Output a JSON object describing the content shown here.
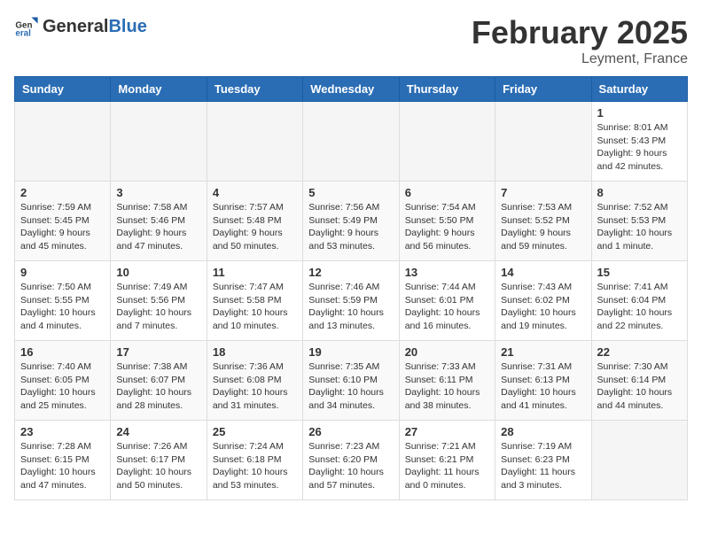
{
  "header": {
    "logo_general": "General",
    "logo_blue": "Blue",
    "month_title": "February 2025",
    "location": "Leyment, France"
  },
  "weekdays": [
    "Sunday",
    "Monday",
    "Tuesday",
    "Wednesday",
    "Thursday",
    "Friday",
    "Saturday"
  ],
  "weeks": [
    [
      {
        "day": "",
        "info": ""
      },
      {
        "day": "",
        "info": ""
      },
      {
        "day": "",
        "info": ""
      },
      {
        "day": "",
        "info": ""
      },
      {
        "day": "",
        "info": ""
      },
      {
        "day": "",
        "info": ""
      },
      {
        "day": "1",
        "info": "Sunrise: 8:01 AM\nSunset: 5:43 PM\nDaylight: 9 hours and 42 minutes."
      }
    ],
    [
      {
        "day": "2",
        "info": "Sunrise: 7:59 AM\nSunset: 5:45 PM\nDaylight: 9 hours and 45 minutes."
      },
      {
        "day": "3",
        "info": "Sunrise: 7:58 AM\nSunset: 5:46 PM\nDaylight: 9 hours and 47 minutes."
      },
      {
        "day": "4",
        "info": "Sunrise: 7:57 AM\nSunset: 5:48 PM\nDaylight: 9 hours and 50 minutes."
      },
      {
        "day": "5",
        "info": "Sunrise: 7:56 AM\nSunset: 5:49 PM\nDaylight: 9 hours and 53 minutes."
      },
      {
        "day": "6",
        "info": "Sunrise: 7:54 AM\nSunset: 5:50 PM\nDaylight: 9 hours and 56 minutes."
      },
      {
        "day": "7",
        "info": "Sunrise: 7:53 AM\nSunset: 5:52 PM\nDaylight: 9 hours and 59 minutes."
      },
      {
        "day": "8",
        "info": "Sunrise: 7:52 AM\nSunset: 5:53 PM\nDaylight: 10 hours and 1 minute."
      }
    ],
    [
      {
        "day": "9",
        "info": "Sunrise: 7:50 AM\nSunset: 5:55 PM\nDaylight: 10 hours and 4 minutes."
      },
      {
        "day": "10",
        "info": "Sunrise: 7:49 AM\nSunset: 5:56 PM\nDaylight: 10 hours and 7 minutes."
      },
      {
        "day": "11",
        "info": "Sunrise: 7:47 AM\nSunset: 5:58 PM\nDaylight: 10 hours and 10 minutes."
      },
      {
        "day": "12",
        "info": "Sunrise: 7:46 AM\nSunset: 5:59 PM\nDaylight: 10 hours and 13 minutes."
      },
      {
        "day": "13",
        "info": "Sunrise: 7:44 AM\nSunset: 6:01 PM\nDaylight: 10 hours and 16 minutes."
      },
      {
        "day": "14",
        "info": "Sunrise: 7:43 AM\nSunset: 6:02 PM\nDaylight: 10 hours and 19 minutes."
      },
      {
        "day": "15",
        "info": "Sunrise: 7:41 AM\nSunset: 6:04 PM\nDaylight: 10 hours and 22 minutes."
      }
    ],
    [
      {
        "day": "16",
        "info": "Sunrise: 7:40 AM\nSunset: 6:05 PM\nDaylight: 10 hours and 25 minutes."
      },
      {
        "day": "17",
        "info": "Sunrise: 7:38 AM\nSunset: 6:07 PM\nDaylight: 10 hours and 28 minutes."
      },
      {
        "day": "18",
        "info": "Sunrise: 7:36 AM\nSunset: 6:08 PM\nDaylight: 10 hours and 31 minutes."
      },
      {
        "day": "19",
        "info": "Sunrise: 7:35 AM\nSunset: 6:10 PM\nDaylight: 10 hours and 34 minutes."
      },
      {
        "day": "20",
        "info": "Sunrise: 7:33 AM\nSunset: 6:11 PM\nDaylight: 10 hours and 38 minutes."
      },
      {
        "day": "21",
        "info": "Sunrise: 7:31 AM\nSunset: 6:13 PM\nDaylight: 10 hours and 41 minutes."
      },
      {
        "day": "22",
        "info": "Sunrise: 7:30 AM\nSunset: 6:14 PM\nDaylight: 10 hours and 44 minutes."
      }
    ],
    [
      {
        "day": "23",
        "info": "Sunrise: 7:28 AM\nSunset: 6:15 PM\nDaylight: 10 hours and 47 minutes."
      },
      {
        "day": "24",
        "info": "Sunrise: 7:26 AM\nSunset: 6:17 PM\nDaylight: 10 hours and 50 minutes."
      },
      {
        "day": "25",
        "info": "Sunrise: 7:24 AM\nSunset: 6:18 PM\nDaylight: 10 hours and 53 minutes."
      },
      {
        "day": "26",
        "info": "Sunrise: 7:23 AM\nSunset: 6:20 PM\nDaylight: 10 hours and 57 minutes."
      },
      {
        "day": "27",
        "info": "Sunrise: 7:21 AM\nSunset: 6:21 PM\nDaylight: 11 hours and 0 minutes."
      },
      {
        "day": "28",
        "info": "Sunrise: 7:19 AM\nSunset: 6:23 PM\nDaylight: 11 hours and 3 minutes."
      },
      {
        "day": "",
        "info": ""
      }
    ]
  ]
}
